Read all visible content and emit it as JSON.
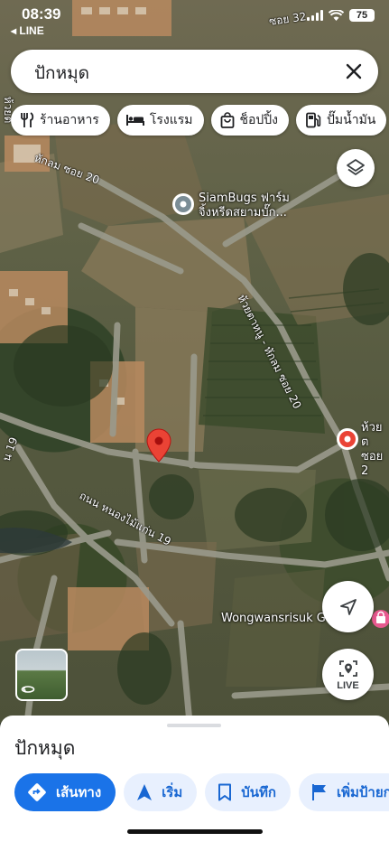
{
  "status_bar": {
    "time": "08:39",
    "back_app": "◂ LINE",
    "battery": "75"
  },
  "search": {
    "query": "ปักหมุด",
    "clear_icon": "close-icon"
  },
  "chips": [
    {
      "label": "ร้านอาหาร",
      "icon": "restaurant-icon"
    },
    {
      "label": "โรงแรม",
      "icon": "hotel-icon"
    },
    {
      "label": "ช็อปปิ้ง",
      "icon": "shopping-icon"
    },
    {
      "label": "ปั๊มน้ำมัน",
      "icon": "gas-station-icon"
    }
  ],
  "map": {
    "poi_siambugs": "SiamBugs ฟาร์ม จิ้งหรีดสยามบั๊ก...",
    "poi_wongwansrisuk": "Wongwansrisuk G",
    "poi_right": "ห้วยต ซอย 2",
    "road_huaiyai": "ห้วยตาหนู - หักลม ซอย 20",
    "road_hakhlom": "หักลม ซอย 20",
    "road_nong": "ถนน หนองไม้แก่น 19",
    "road_left_top": "ห้วยต",
    "road_left_mid": "น 19",
    "road_top_right": "ซอย 32",
    "live_label": "LIVE"
  },
  "sheet": {
    "title": "ปักหมุด",
    "actions": [
      {
        "label": "เส้นทาง",
        "icon": "directions-icon",
        "primary": true
      },
      {
        "label": "เริ่ม",
        "icon": "navigation-arrow-icon",
        "primary": false
      },
      {
        "label": "บันทึก",
        "icon": "bookmark-icon",
        "primary": false
      },
      {
        "label": "เพิ่มป้ายก",
        "icon": "flag-icon",
        "primary": false
      }
    ]
  },
  "colors": {
    "accent": "#1a73e8",
    "pin_red": "#ea4335",
    "secondary_bg": "#e8f0fe"
  }
}
